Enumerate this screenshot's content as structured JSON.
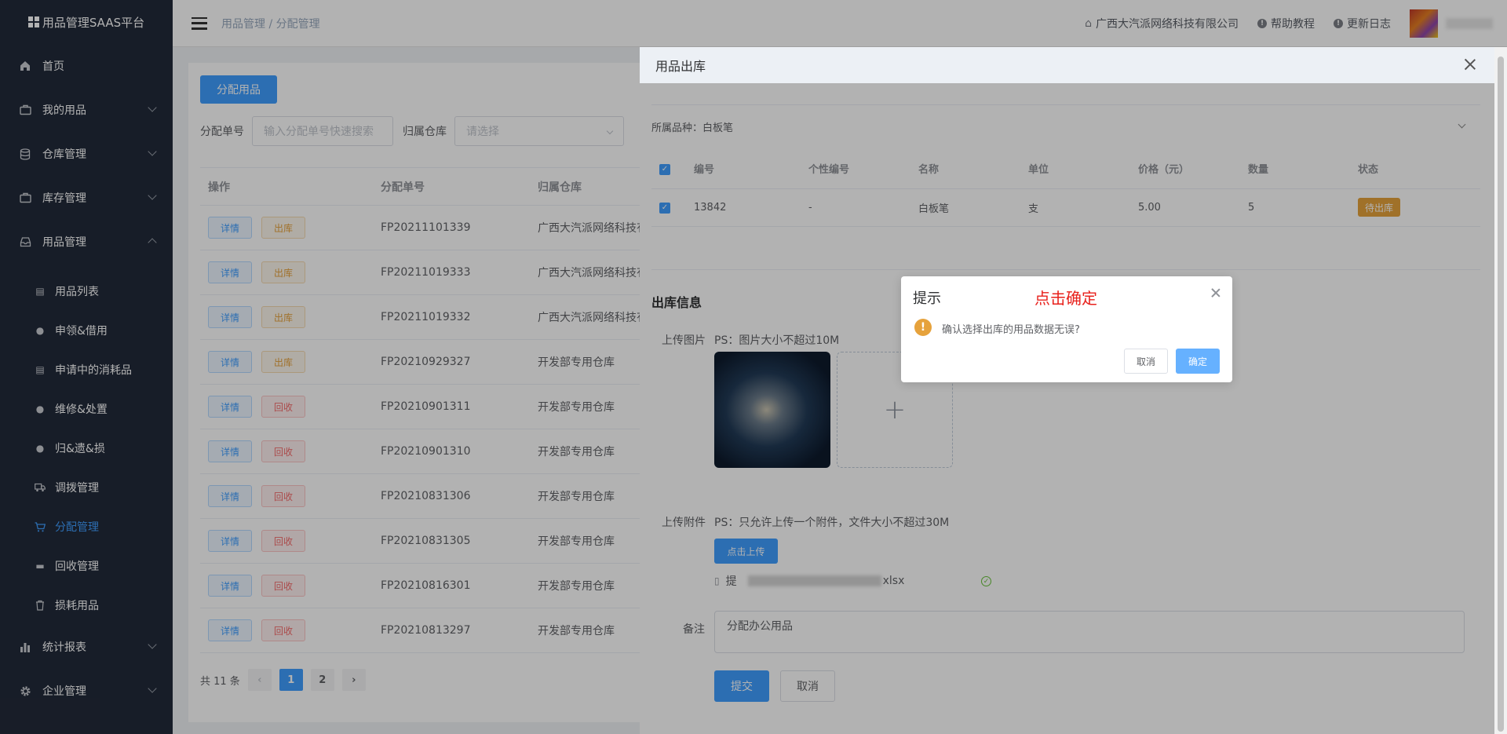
{
  "app": {
    "title": "用品管理SAAS平台"
  },
  "sidebar": {
    "items": [
      {
        "label": "首页"
      },
      {
        "label": "我的用品"
      },
      {
        "label": "仓库管理"
      },
      {
        "label": "库存管理"
      },
      {
        "label": "用品管理"
      }
    ],
    "sub_items": [
      {
        "label": "用品列表"
      },
      {
        "label": "申领&借用"
      },
      {
        "label": "申请中的消耗品"
      },
      {
        "label": "维修&处置"
      },
      {
        "label": "归&遗&损"
      },
      {
        "label": "调拨管理"
      },
      {
        "label": "分配管理"
      },
      {
        "label": "回收管理"
      },
      {
        "label": "损耗用品"
      }
    ],
    "bottom_items": [
      {
        "label": "统计报表"
      },
      {
        "label": "企业管理"
      }
    ]
  },
  "header": {
    "breadcrumb": "用品管理 / 分配管理",
    "company": "广西大汽派网络科技有限公司",
    "help": "帮助教程",
    "changelog": "更新日志"
  },
  "page": {
    "assign_button": "分配用品",
    "filter_no_label": "分配单号",
    "filter_no_placeholder": "输入分配单号快速搜索",
    "filter_wh_label": "归属仓库",
    "filter_wh_placeholder": "请选择",
    "columns": [
      "操作",
      "分配单号",
      "归属仓库"
    ],
    "detail_label": "详情",
    "rows": [
      {
        "action": "出库",
        "kind": "warn",
        "no": "FP20211101339",
        "wh": "广西大汽派网络科技有"
      },
      {
        "action": "出库",
        "kind": "warn",
        "no": "FP20211019333",
        "wh": "广西大汽派网络科技有"
      },
      {
        "action": "出库",
        "kind": "warn",
        "no": "FP20211019332",
        "wh": "广西大汽派网络科技有"
      },
      {
        "action": "出库",
        "kind": "warn",
        "no": "FP20210929327",
        "wh": "开发部专用仓库"
      },
      {
        "action": "回收",
        "kind": "danger",
        "no": "FP20210901311",
        "wh": "开发部专用仓库"
      },
      {
        "action": "回收",
        "kind": "danger",
        "no": "FP20210901310",
        "wh": "开发部专用仓库"
      },
      {
        "action": "回收",
        "kind": "danger",
        "no": "FP20210831306",
        "wh": "开发部专用仓库"
      },
      {
        "action": "回收",
        "kind": "danger",
        "no": "FP20210831305",
        "wh": "开发部专用仓库"
      },
      {
        "action": "回收",
        "kind": "danger",
        "no": "FP20210816301",
        "wh": "开发部专用仓库"
      },
      {
        "action": "回收",
        "kind": "danger",
        "no": "FP20210813297",
        "wh": "开发部专用仓库"
      }
    ],
    "total": "共 11 条",
    "pages": [
      "1",
      "2"
    ]
  },
  "drawer": {
    "title": "用品出库",
    "category": "所属品种：白板笔",
    "columns": [
      "编号",
      "个性编号",
      "名称",
      "单位",
      "价格（元）",
      "数量",
      "状态"
    ],
    "row": {
      "code": "13842",
      "custom": "-",
      "name": "白板笔",
      "unit": "支",
      "price": "5.00",
      "qty": "5",
      "status": "待出库"
    },
    "section_title": "出库信息",
    "image_label": "上传图片",
    "image_hint": "PS：图片大小不超过10M",
    "attach_label": "上传附件",
    "attach_hint": "PS：只允许上传一个附件，文件大小不超过30M",
    "upload_button": "点击上传",
    "file_prefix": "提",
    "file_suffix": "xlsx",
    "remark_label": "备注",
    "remark_value": "分配办公用品",
    "submit": "提交",
    "cancel": "取消"
  },
  "dialog": {
    "title": "提示",
    "annotation": "点击确定",
    "message": "确认选择出库的用品数据无误?",
    "cancel": "取消",
    "confirm": "确定"
  }
}
